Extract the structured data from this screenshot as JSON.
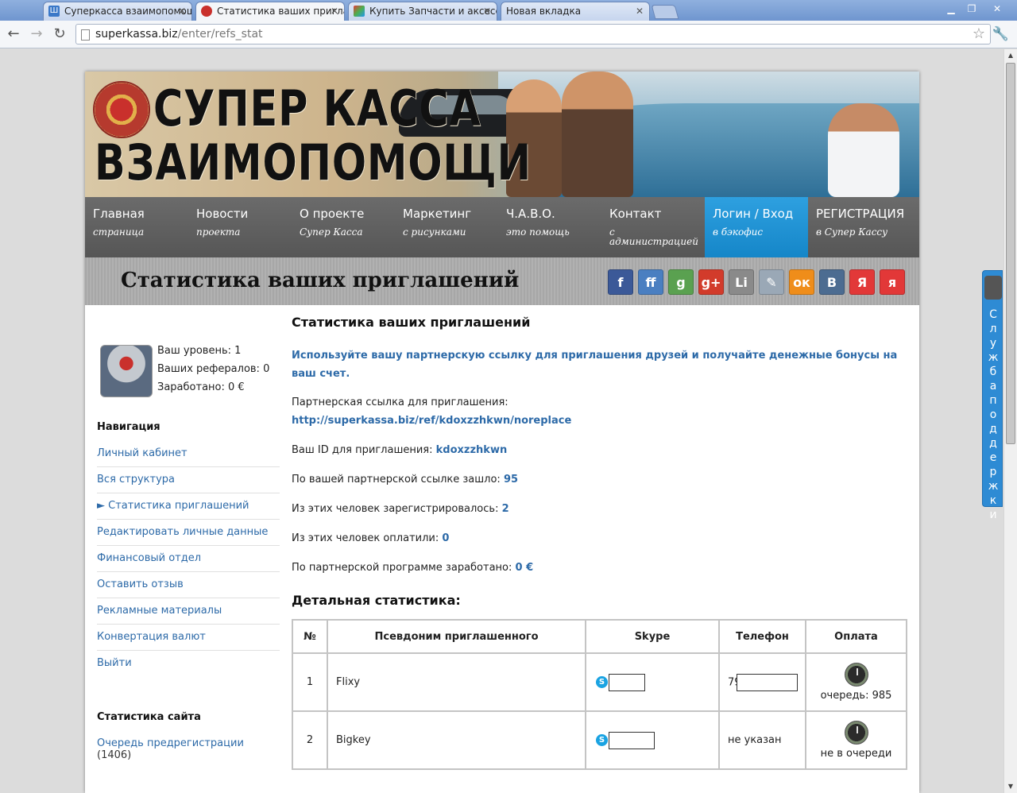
{
  "browser": {
    "tabs": [
      {
        "label": "Суперкасса взаимопомощи",
        "fav": "Ш",
        "favColor": "#3a78c8"
      },
      {
        "label": "Статистика ваших приглаш",
        "fav": "",
        "favColor": "#c9302c"
      },
      {
        "label": "Купить Запчасти и аксессуа",
        "fav": "",
        "favColor": "#4caf50"
      },
      {
        "label": "Новая вкладка",
        "fav": "",
        "favColor": "transparent"
      }
    ],
    "url_host": "superkassa.biz",
    "url_path": "/enter/refs_stat"
  },
  "banner": {
    "title_line1": "СУПЕР КАССА",
    "title_line2": "ВЗАИМОПОМОЩИ"
  },
  "nav": [
    {
      "title": "Главная",
      "sub": "страница"
    },
    {
      "title": "Новости",
      "sub": "проекта"
    },
    {
      "title": "О проекте",
      "sub": "Супер Касса"
    },
    {
      "title": "Маркетинг",
      "sub": "с рисунками"
    },
    {
      "title": "Ч.А.В.О.",
      "sub": "это помощь"
    },
    {
      "title": "Контакт",
      "sub": "с администрацией"
    },
    {
      "title": "Логин / Вход",
      "sub": "в бэкофис"
    },
    {
      "title": "РЕГИСТРАЦИЯ",
      "sub": "в Супер Кассу"
    }
  ],
  "page_title": "Статистика ваших приглашений",
  "social": [
    {
      "glyph": "f",
      "color": "#3b5998"
    },
    {
      "glyph": "ff",
      "color": "#4a7fc1"
    },
    {
      "glyph": "g",
      "color": "#5aa150"
    },
    {
      "glyph": "g+",
      "color": "#d23b2b"
    },
    {
      "glyph": "Li",
      "color": "#8a8a8a"
    },
    {
      "glyph": "✎",
      "color": "#9aa8b6"
    },
    {
      "glyph": "ок",
      "color": "#ef8d1a"
    },
    {
      "glyph": "В",
      "color": "#4c6c91"
    },
    {
      "glyph": "Я",
      "color": "#e23838"
    },
    {
      "glyph": "я",
      "color": "#e23838"
    }
  ],
  "sidebar": {
    "level": "Ваш уровень: 1",
    "refs": "Ваших рефералов: 0",
    "earned": "Заработано: 0 €",
    "nav_heading": "Навигация",
    "links": [
      "Личный кабинет",
      "Вся структура",
      "► Статистика приглашений",
      "Редактировать личные данные",
      "Финансовый отдел",
      "Оставить отзыв",
      "Рекламные материалы",
      "Конвертация валют",
      "Выйти"
    ],
    "stats_heading": "Статистика сайта",
    "queue_link": "Очередь предрегистрации",
    "queue_count": "(1406)"
  },
  "content": {
    "heading": "Статистика ваших приглашений",
    "intro": "Используйте вашу партнерскую ссылку для приглашения друзей и получайте денежные бонусы на ваш счет.",
    "ref_label": "Партнерская ссылка для приглашения:",
    "ref_link": "http://superkassa.biz/ref/kdoxzzhkwn/noreplace",
    "id_label": "Ваш ID для приглашения:",
    "id_value": "kdoxzzhkwn",
    "visits_label": "По вашей партнерской ссылке зашло:",
    "visits_value": "95",
    "registered_label": "Из этих человек зарегистрировалось:",
    "registered_value": "2",
    "paid_label": "Из этих человек оплатили:",
    "paid_value": "0",
    "earned_label": "По партнерской программе заработано:",
    "earned_value": "0 €",
    "detail_heading": "Детальная статистика:",
    "table": {
      "headers": [
        "№",
        "Псевдоним приглашенного",
        "Skype",
        "Телефон",
        "Оплата"
      ],
      "rows": [
        {
          "num": "1",
          "nick": "Flixy",
          "phone": "79",
          "pay": "очередь: 985"
        },
        {
          "num": "2",
          "nick": "Bigkey",
          "phone": "не указан",
          "pay": "не в очереди"
        }
      ]
    }
  },
  "support_label": "Служба поддержки"
}
